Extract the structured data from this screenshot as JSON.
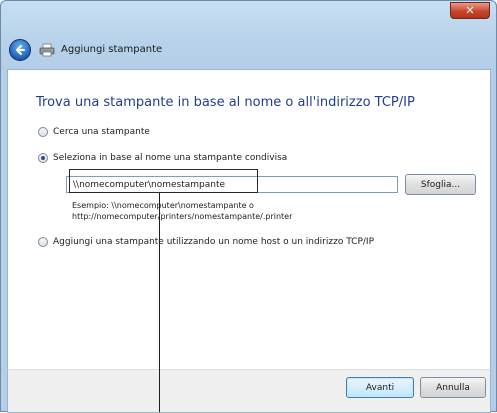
{
  "window": {
    "title": "Aggiungi stampante",
    "close_glyph": "✕"
  },
  "icons": {
    "back": "back-arrow-icon",
    "printer": "printer-icon"
  },
  "content": {
    "heading": "Trova una stampante in base al nome o all'indirizzo TCP/IP",
    "options": [
      {
        "label": "Cerca una stampante",
        "selected": false
      },
      {
        "label": "Seleziona in base al nome una stampante condivisa",
        "selected": true
      },
      {
        "label": "Aggiungi una stampante utilizzando un nome host o un indirizzo TCP/IP",
        "selected": false
      }
    ],
    "shared_printer_path": "\\\\nomecomputer\\nomestampante",
    "browse_label": "Sfoglia...",
    "example_line1": "Esempio: \\\\nomecomputer\\nomestampante o",
    "example_line2": "http://nomecomputer/printers/nomestampante/.printer"
  },
  "footer": {
    "next_label": "Avanti",
    "cancel_label": "Annulla"
  },
  "colors": {
    "heading": "#1f3f8f",
    "close_button": "#c8452c"
  }
}
